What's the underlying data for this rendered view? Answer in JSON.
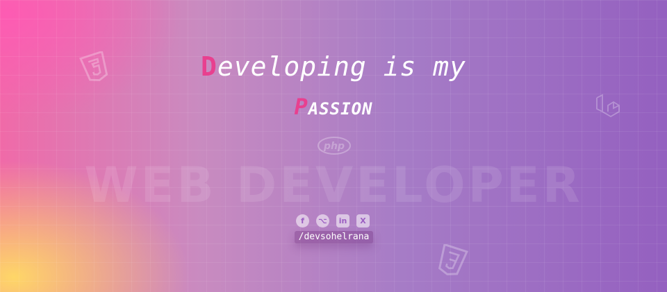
{
  "headline": {
    "first_letter": "D",
    "rest": "eveloping is my"
  },
  "subline": {
    "first_letter": "P",
    "rest": "ASSION"
  },
  "watermark": "WEB DEVELOPER",
  "deco_icons": {
    "html5": "html5-logo-icon",
    "laravel": "laravel-logo-icon",
    "php": "php-logo-icon",
    "css3": "css3-logo-icon",
    "php_text": "php"
  },
  "socials": [
    {
      "icon": "facebook-icon",
      "glyph": "f"
    },
    {
      "icon": "github-icon",
      "glyph": "⌥"
    },
    {
      "icon": "linkedin-icon",
      "glyph": "in"
    },
    {
      "icon": "x-twitter-icon",
      "glyph": "X"
    }
  ],
  "handle": "/devsohelrana",
  "colors": {
    "accent": "#e8408f",
    "bg_left_top": "#f06aa8",
    "bg_left_bottom": "#ffdc64",
    "bg_right": "#9460c0"
  }
}
